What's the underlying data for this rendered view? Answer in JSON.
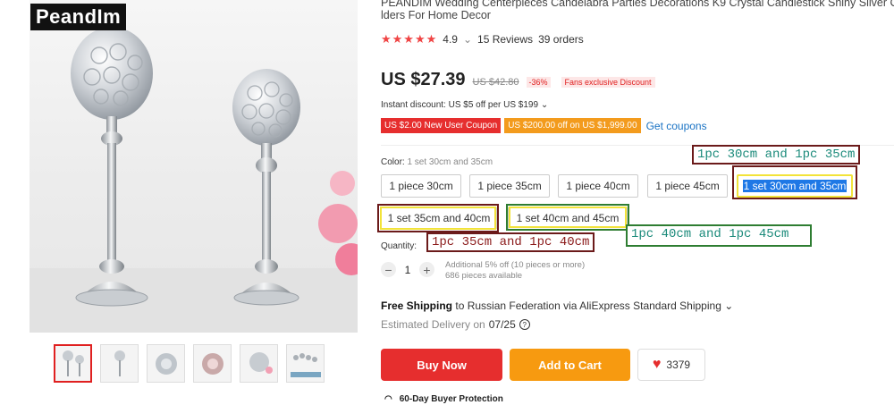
{
  "brand": "PeandIm",
  "product": {
    "title_line1": "PEANDIM Wedding Centerpieces Candelabra Parties Decorations K9 Crystal Candlestick Shiny Silver Candle H",
    "title_line2": "lders For Home Decor",
    "rating": "4.9",
    "reviews": "15 Reviews",
    "orders": "39 orders",
    "price": "US $27.39",
    "old_price": "US $42.80",
    "discount": "-36%",
    "fans_badge": "Fans exclusive Discount",
    "instant_discount": "Instant discount: US $5 off per US $199"
  },
  "coupons": {
    "new_user": "US $2.00 New User Coupon",
    "store": "US $200.00 off on US $1,999.00",
    "get_link": "Get coupons"
  },
  "color": {
    "label": "Color:",
    "selected": "1 set 30cm and 35cm",
    "options": [
      "1 piece 30cm",
      "1 piece 35cm",
      "1 piece 40cm",
      "1 piece 45cm",
      "1 set 30cm and 35cm",
      "1 set 35cm and 40cm",
      "1 set 40cm and 45cm"
    ]
  },
  "annotations": {
    "a1": "1pc 30cm and 1pc 35cm",
    "a2": "1pc 35cm and 1pc 40cm",
    "a3": "1pc 40cm and 1pc 45cm",
    "colors": {
      "dark_red": "#6b1a1a",
      "yellow": "#f2e33a",
      "green": "#2e7d32"
    }
  },
  "quantity": {
    "label": "Quantity:",
    "minus": "−",
    "value": "1",
    "plus": "+",
    "note1": "Additional 5% off (10 pieces or more)",
    "note2": "686 pieces available"
  },
  "shipping": {
    "free": "Free Shipping",
    "detail": "to Russian Federation via AliExpress Standard Shipping",
    "estimated_label": "Estimated Delivery on",
    "estimated_date": "07/25"
  },
  "actions": {
    "buy_now": "Buy Now",
    "add_to_cart": "Add to Cart",
    "wishlist_count": "3379"
  },
  "protection": "60-Day Buyer Protection",
  "colors": {
    "red": "#e62e2e",
    "orange": "#f79a10",
    "link": "#1a73c4",
    "select": "#1e78e6"
  }
}
